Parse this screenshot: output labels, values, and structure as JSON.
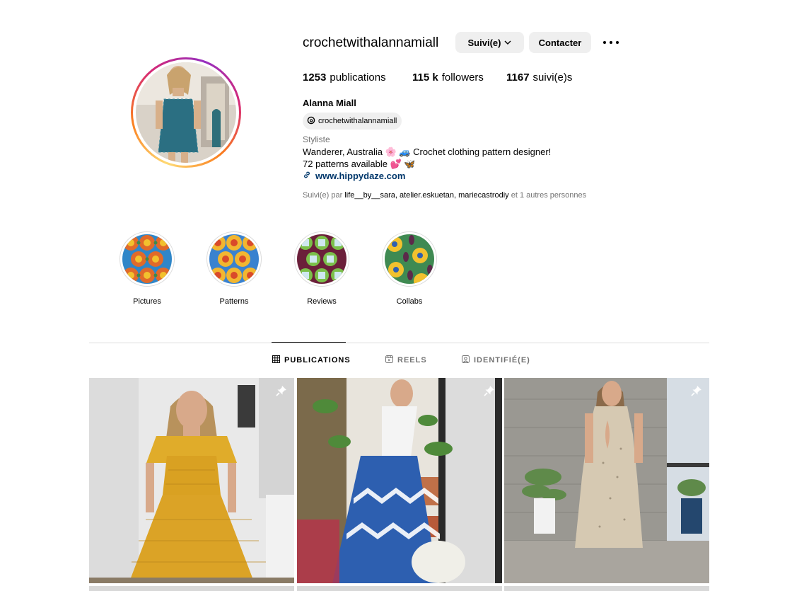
{
  "profile": {
    "username": "crochetwithalannamiall",
    "follow_button": "Suivi(e)",
    "contact_button": "Contacter",
    "stats": {
      "posts_count": "1253",
      "posts_label": "publications",
      "followers_count": "115 k",
      "followers_label": "followers",
      "following_count": "1167",
      "following_label": "suivi(e)s"
    },
    "full_name": "Alanna Miall",
    "threads_handle": "crochetwithalannamiall",
    "category": "Styliste",
    "bio_line1": "Wanderer, Australia 🌸 🚙 Crochet clothing pattern designer!",
    "bio_line2": "72 patterns available 💕 🦋",
    "website": "www.hippydaze.com",
    "followed_by_prefix": "Suivi(e) par",
    "followed_by_users": "life__by__sara, atelier.eskuetan, mariecastrodiy",
    "followed_by_suffix": "et 1 autres personnes"
  },
  "highlights": [
    {
      "label": "Pictures"
    },
    {
      "label": "Patterns"
    },
    {
      "label": "Reviews"
    },
    {
      "label": "Collabs"
    }
  ],
  "tabs": [
    {
      "label": "PUBLICATIONS",
      "icon": "grid-icon",
      "active": true
    },
    {
      "label": "REELS",
      "icon": "reels-icon",
      "active": false
    },
    {
      "label": "IDENTIFIÉ(E)",
      "icon": "tagged-icon",
      "active": false
    }
  ],
  "posts": [
    {
      "pinned": true,
      "icon": "pin-icon"
    },
    {
      "pinned": true,
      "icon": "pin-icon"
    },
    {
      "pinned": true,
      "icon": "pin-icon"
    }
  ],
  "colors": {
    "link": "#00376b",
    "secondary_text": "#737373",
    "button_bg": "#efefef",
    "divider": "#dbdbdb"
  }
}
